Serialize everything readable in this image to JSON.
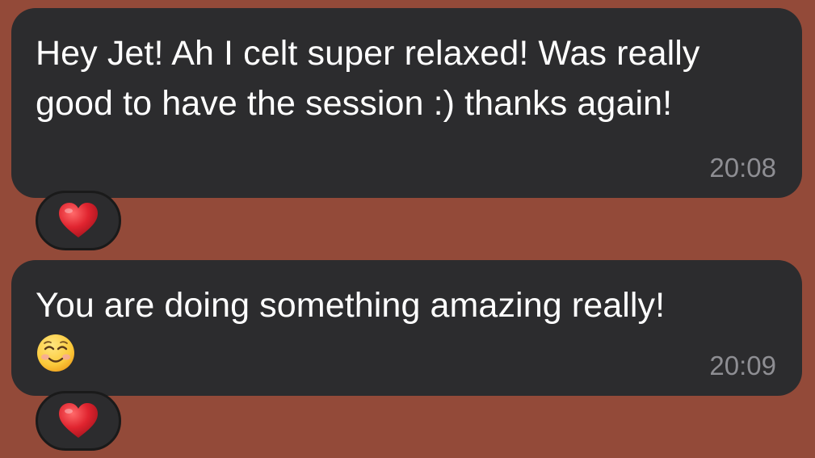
{
  "messages": [
    {
      "text": "Hey Jet! Ah I celt super relaxed! Was really good to have the session :) thanks again!",
      "time": "20:08",
      "reaction": "red-heart-icon"
    },
    {
      "text": "You are doing something amazing really!",
      "emoji": "smiling-face-icon",
      "time": "20:09",
      "reaction": "red-heart-icon"
    }
  ],
  "colors": {
    "background": "#934A39",
    "bubble": "#2C2C2E",
    "text": "#FFFFFF",
    "timestamp": "#8E8E93",
    "heart": "#E0242F"
  }
}
